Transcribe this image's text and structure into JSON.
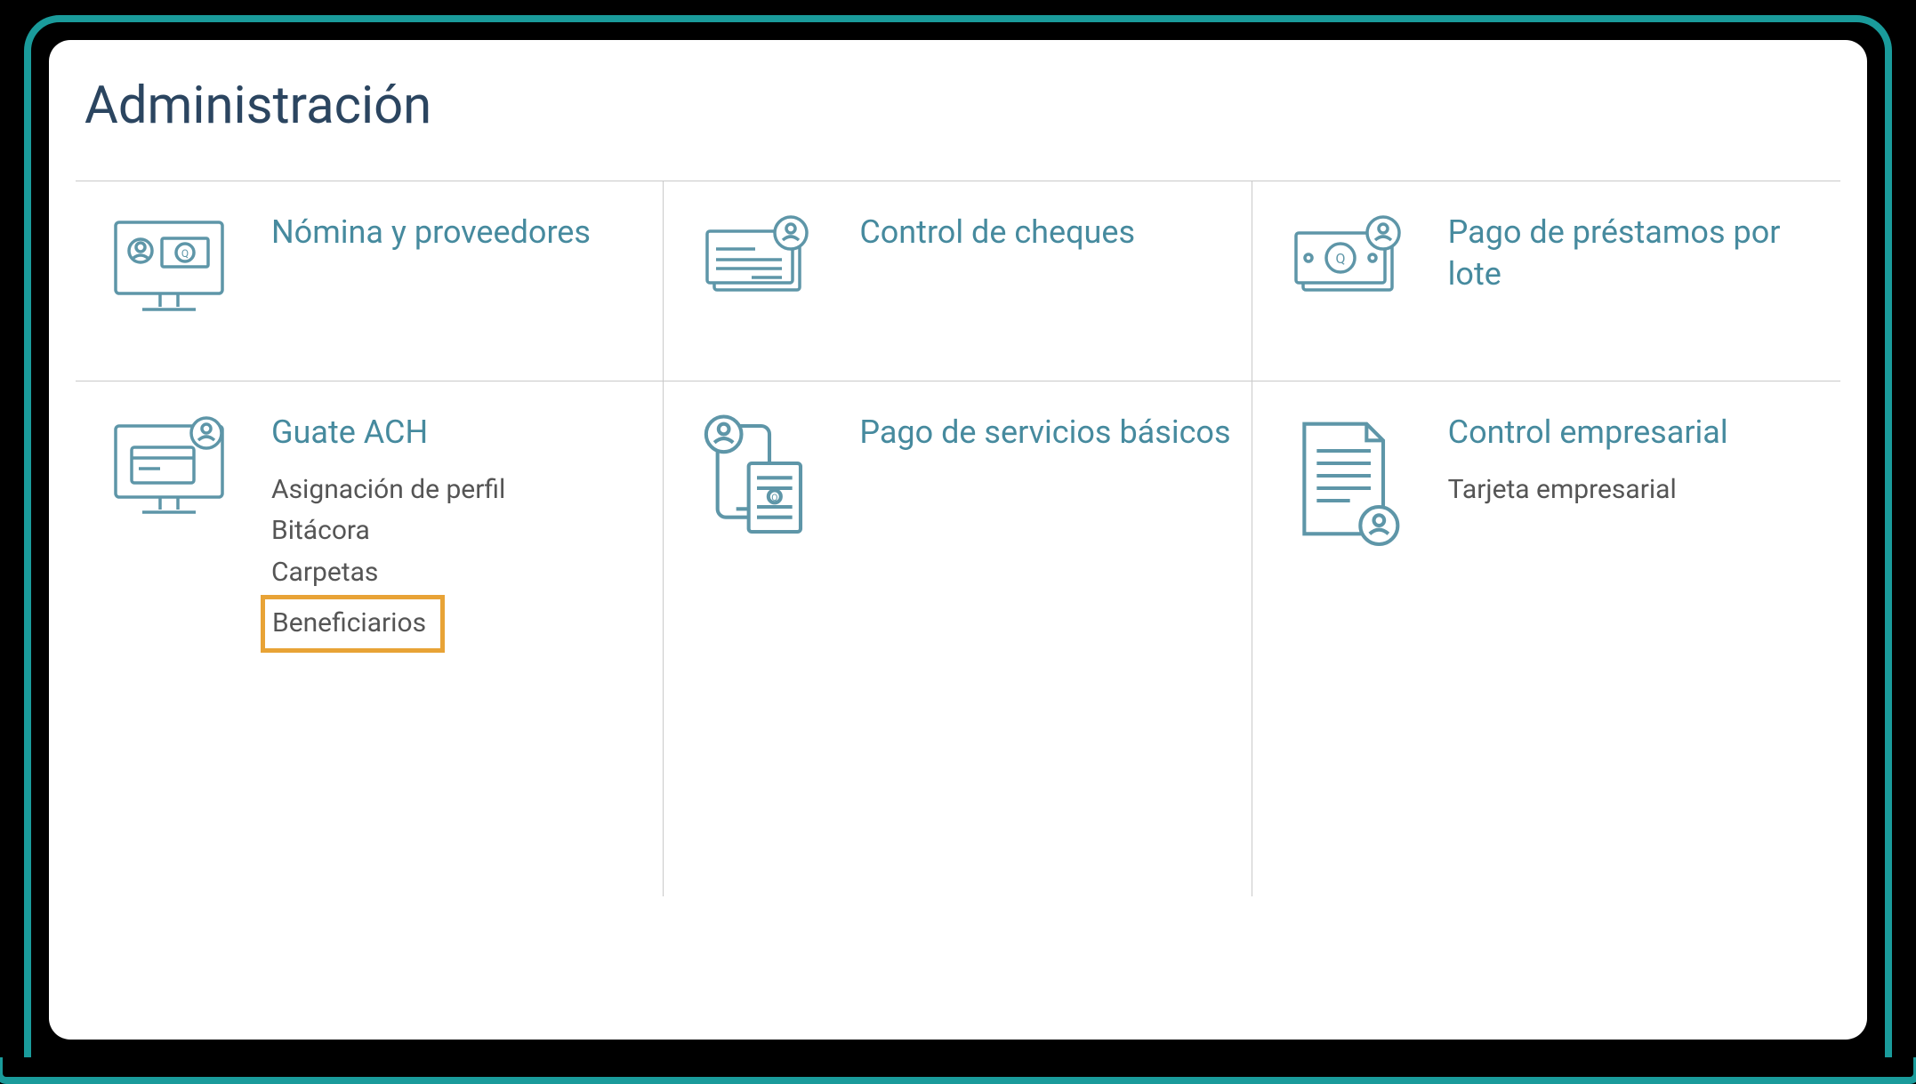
{
  "page": {
    "title": "Administración"
  },
  "cards": {
    "nomina": {
      "title": "Nómina y proveedores"
    },
    "cheques": {
      "title": "Control de cheques"
    },
    "prestamos": {
      "title": "Pago de préstamos por lote"
    },
    "guateach": {
      "title": "Guate ACH",
      "subitems": {
        "perfil": "Asignación de perfil",
        "bitacora": "Bitácora",
        "carpetas": "Carpetas",
        "beneficiarios": "Beneficiarios"
      }
    },
    "servicios": {
      "title": "Pago de servicios básicos"
    },
    "empresarial": {
      "title": "Control empresarial",
      "subitems": {
        "tarjeta": "Tarjeta empresarial"
      }
    }
  },
  "colors": {
    "teal": "#5e96a8",
    "darkBlue": "#2b4560",
    "highlight": "#e8a336"
  }
}
